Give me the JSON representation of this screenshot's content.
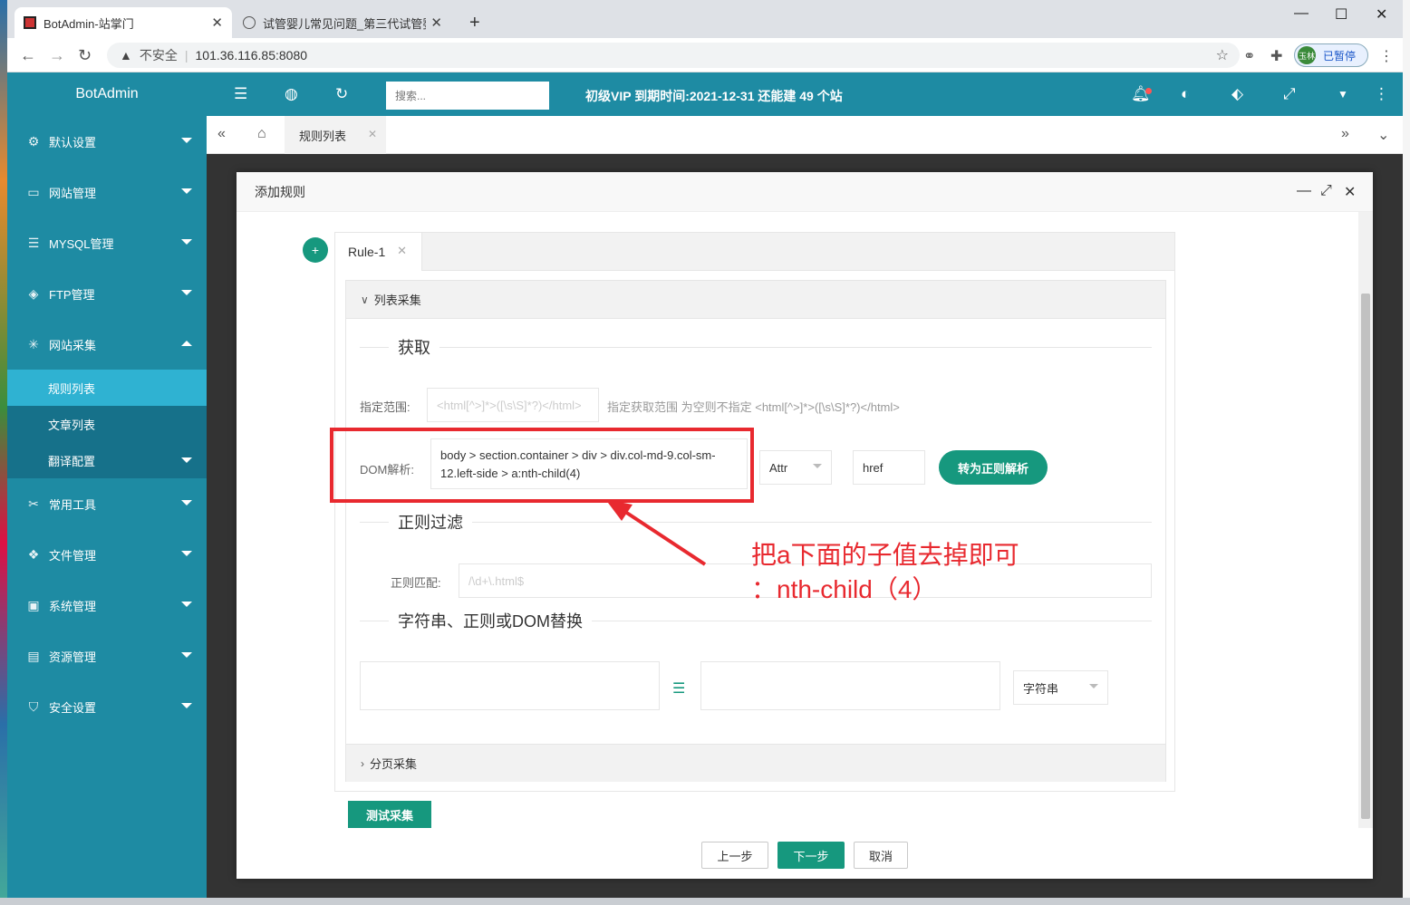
{
  "browser": {
    "tabs": [
      {
        "title": "BotAdmin-站掌门",
        "active": true
      },
      {
        "title": "试管婴儿常见问题_第三代试管婴",
        "active": false
      }
    ],
    "security_label": "不安全",
    "url": "101.36.116.85:8080",
    "profile_label": "已暂停",
    "profile_avatar": "玉林"
  },
  "app": {
    "brand": "BotAdmin",
    "search_placeholder": "搜索...",
    "vip_notice": "初级VIP 到期时间:2021-12-31 还能建 49 个站",
    "accent_color": "#1e8ba3",
    "active_color": "#2fb2d2",
    "button_color": "#16987e"
  },
  "sidebar": {
    "items": [
      {
        "label": "默认设置",
        "icon": "gear-icon"
      },
      {
        "label": "网站管理",
        "icon": "monitor-icon"
      },
      {
        "label": "MYSQL管理",
        "icon": "database-icon"
      },
      {
        "label": "FTP管理",
        "icon": "ftp-icon"
      },
      {
        "label": "网站采集",
        "icon": "bug-icon",
        "expanded": true
      },
      {
        "label": "常用工具",
        "icon": "tools-icon"
      },
      {
        "label": "文件管理",
        "icon": "files-icon"
      },
      {
        "label": "系统管理",
        "icon": "system-icon"
      },
      {
        "label": "资源管理",
        "icon": "resource-icon"
      },
      {
        "label": "安全设置",
        "icon": "shield-icon"
      }
    ],
    "sub_items": [
      {
        "label": "规则列表",
        "active": true
      },
      {
        "label": "文章列表"
      },
      {
        "label": "翻译配置"
      }
    ]
  },
  "page_tabs": {
    "current": "规则列表"
  },
  "modal": {
    "title": "添加规则",
    "rule_tab": "Rule-1",
    "list_section": "列表采集",
    "page_section": "分页采集",
    "fetch_legend": "获取",
    "range_label": "指定范围:",
    "range_placeholder": "<html[^>]*>([\\s\\S]*?)</html>",
    "range_hint": "指定获取范围 为空则不指定 <html[^>]*>([\\s\\S]*?)</html>",
    "dom_label": "DOM解析:",
    "dom_value": "body > section.container > div > div.col-md-9.col-sm-12.left-side > a:nth-child(4)",
    "attr_select": "Attr",
    "attr_value": "href",
    "convert_button": "转为正则解析",
    "regex_legend": "正则过滤",
    "regex_label": "正则匹配:",
    "regex_placeholder": "/\\d+\\.html$",
    "replace_legend": "字符串、正则或DOM替换",
    "replace_type": "字符串",
    "test_button": "测试采集",
    "prev_button": "上一步",
    "next_button": "下一步",
    "cancel_button": "取消"
  },
  "annotation": {
    "line1": "把a下面的子值去掉即可",
    "line2": "：nth-child（4）",
    "color": "#e8292f"
  }
}
